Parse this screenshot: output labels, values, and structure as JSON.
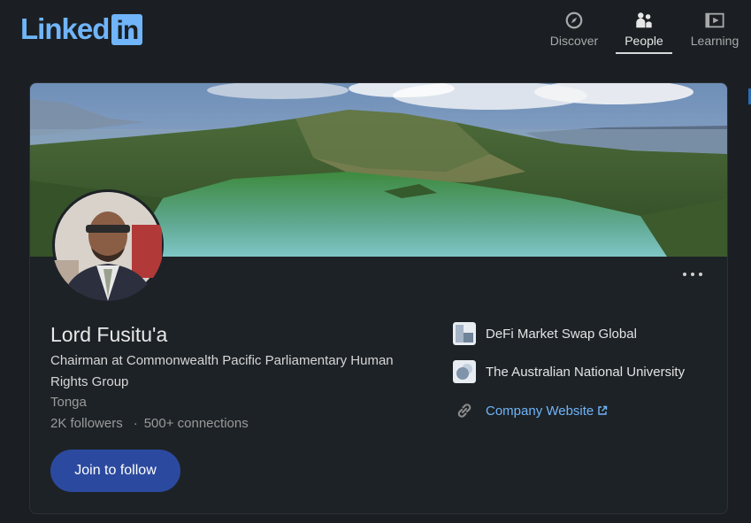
{
  "header": {
    "logo_text": "Linked",
    "logo_box": "in",
    "nav": [
      {
        "label": "Discover",
        "icon": "compass-icon",
        "active": false
      },
      {
        "label": "People",
        "icon": "people-icon",
        "active": true
      },
      {
        "label": "Learning",
        "icon": "video-icon",
        "active": false
      }
    ]
  },
  "profile": {
    "name": "Lord Fusitu'a",
    "headline": "Chairman at Commonwealth Pacific Parliamentary Human Rights Group",
    "location": "Tonga",
    "followers": "2K followers",
    "separator": "·",
    "connections": "500+ connections",
    "follow_label": "Join to follow",
    "banner_image": "crater-lake-landscape",
    "avatar_image": "profile-photo"
  },
  "sidebar": {
    "company": "DeFi Market Swap Global",
    "education": "The Australian National University",
    "website_label": "Company Website"
  },
  "colors": {
    "background": "#1b1f23",
    "accent": "#70b5f9",
    "button": "#2b4a9f"
  }
}
